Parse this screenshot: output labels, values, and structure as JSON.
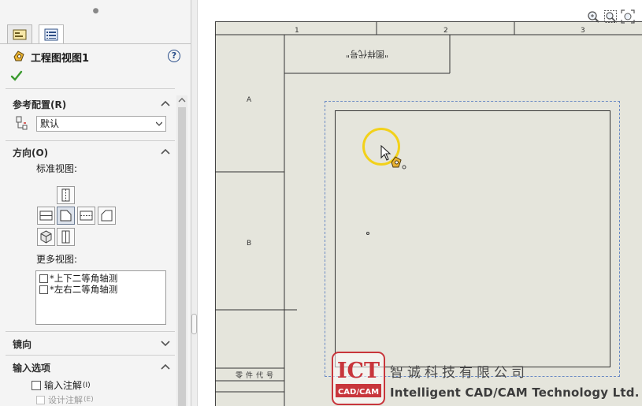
{
  "property_manager": {
    "title": "工程图视图1",
    "tabs": [
      {
        "icon": "property-manager-tab-icon",
        "active": false
      },
      {
        "icon": "configuration-list-tab-icon",
        "active": true
      }
    ],
    "sections": {
      "reference_config": {
        "label": "参考配置(R)",
        "selected": "默认"
      },
      "orientation": {
        "label": "方向(O)",
        "standard_views_label": "标准视图:",
        "more_views_label": "更多视图:",
        "more_views": [
          "*上下二等角轴测",
          "*左右二等角轴测"
        ]
      },
      "mirror": {
        "label": "镜向"
      },
      "import_options": {
        "label": "输入选项",
        "import_annotations": "输入注解",
        "import_annotations_key": "(I)",
        "design_annotations": "设计注解",
        "design_annotations_key": "(E)"
      }
    }
  },
  "drawing_sheet": {
    "zone_columns": [
      "1",
      "2",
      "3"
    ],
    "zone_rows": [
      "A",
      "B"
    ],
    "title_box_text": "\"图样代号\"",
    "part_code_label": "零件代号"
  },
  "watermark": {
    "logo_text": "ICT",
    "logo_sub": "CAD/CAM",
    "company_cn": "智诚科技有限公司",
    "company_en": "Intelligent CAD/CAM Technology Ltd."
  },
  "colors": {
    "sheet": "#e5e5dc",
    "highlight_ring": "#f2d11a",
    "view_boundary": "#6a8ac4",
    "logo_red": "#c8363c",
    "ok_green": "#3a9a2e"
  }
}
